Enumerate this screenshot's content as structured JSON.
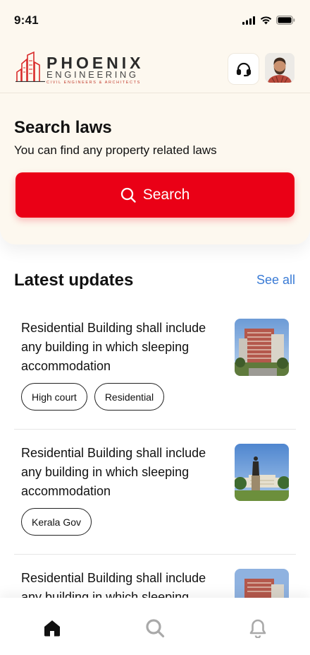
{
  "status_bar": {
    "time": "9:41"
  },
  "brand": {
    "name": "PHOENIX",
    "subtitle": "ENGINEERING",
    "tagline": "CIVIL ENGINEERS & ARCHITECTS",
    "accent": "#ea0016"
  },
  "search": {
    "title": "Search laws",
    "subtitle": "You can find any property related laws",
    "button_label": "Search"
  },
  "updates": {
    "title": "Latest updates",
    "see_all": "See all",
    "items": [
      {
        "text": "Residential Building shall include any building in which sleeping accommodation",
        "tags": [
          "High court",
          "Residential"
        ],
        "image": "building-photo"
      },
      {
        "text": "Residential Building shall include any building in which sleeping accommodation",
        "tags": [
          "Kerala Gov"
        ],
        "image": "statue-photo"
      },
      {
        "text": "Residential Building shall include any building in which sleeping accommodation",
        "tags": [],
        "image": "building-photo"
      }
    ]
  },
  "nav": {
    "items": [
      "home",
      "search",
      "notifications"
    ],
    "active": "home"
  },
  "colors": {
    "primary": "#ea0016",
    "link": "#3a7bd5",
    "header_bg": "#fdf8ef"
  }
}
